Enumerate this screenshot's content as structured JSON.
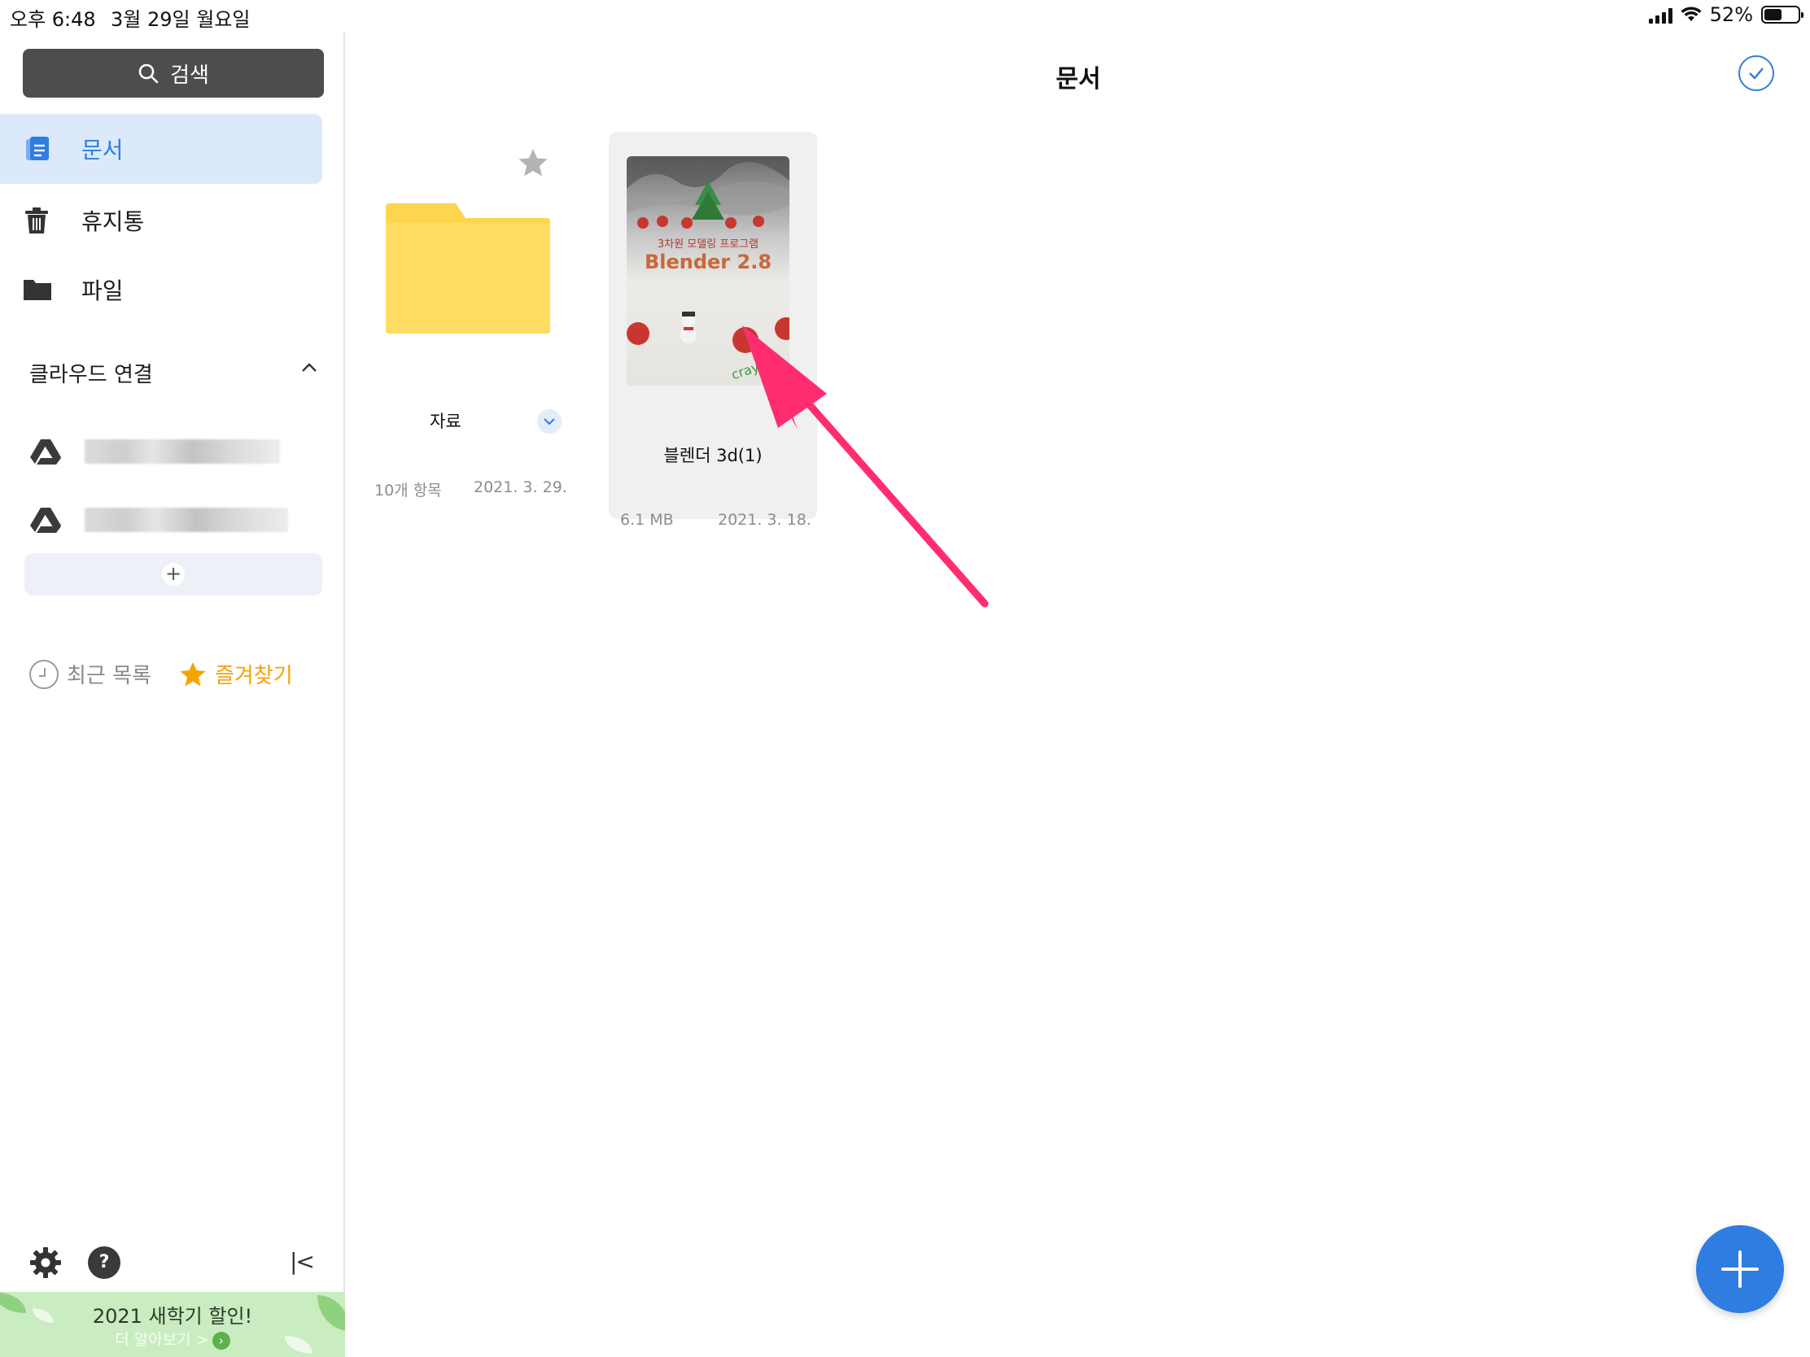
{
  "status": {
    "time": "오후 6:48",
    "date": "3월 29일 월요일",
    "battery": "52%",
    "battery_level": 0.52
  },
  "sidebar": {
    "search_label": "검색",
    "items": [
      {
        "label": "문서",
        "icon": "document-icon",
        "active": true
      },
      {
        "label": "휴지통",
        "icon": "trash-icon",
        "active": false
      },
      {
        "label": "파일",
        "icon": "folder-icon",
        "active": false
      }
    ],
    "cloud_header": "클라우드 연결",
    "cloud_accounts": [
      {
        "icon": "google-drive-icon"
      },
      {
        "icon": "google-drive-icon"
      }
    ],
    "add_label": "+",
    "recent_label": "최근 목록",
    "favorites_label": "즐겨찾기",
    "help_label": "?",
    "collapse_label": "|<",
    "promo": {
      "title": "2021 새학기 할인!",
      "subtitle": "더 알아보기 >"
    }
  },
  "main": {
    "title": "문서",
    "items": [
      {
        "type": "folder",
        "name": "자료",
        "meta_left": "10개 항목",
        "meta_right": "2021. 3. 29."
      },
      {
        "type": "document",
        "name": "블렌더 3d(1)",
        "meta_left": "6.1 MB",
        "meta_right": "2021. 3. 18.",
        "thumb_text_1": "3차원 모델링 프로그램",
        "thumb_text_2": "Blender 2.8",
        "thumb_text_3": "cray fall"
      }
    ]
  },
  "colors": {
    "accent": "#2f7de1",
    "folder": "#ffd54f",
    "favorite": "#f5a300",
    "arrow": "#ff2d6f"
  }
}
